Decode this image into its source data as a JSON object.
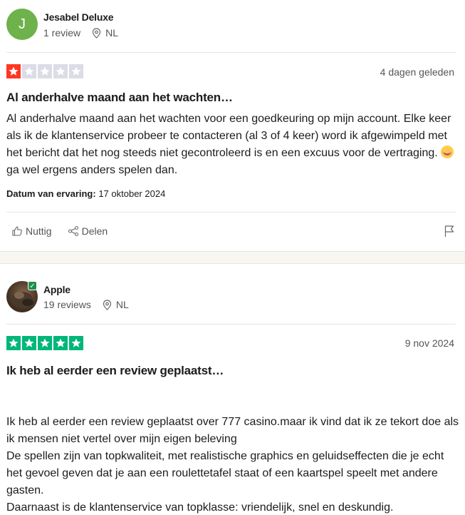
{
  "reviews": [
    {
      "reviewer": {
        "initial": "J",
        "name": "Jesabel Deluxe",
        "review_count": "1 review",
        "country": "NL",
        "avatar_color": "#6db24a"
      },
      "rating": 1,
      "star_color": "#ff3722",
      "date": "4 dagen geleden",
      "title": "Al anderhalve maand aan het wachten…",
      "body_before_emoji": "Al anderhalve maand aan het wachten voor een goedkeuring op mijn account. Elke keer als ik de klantenservice probeer te contacteren (al 3 of 4 keer) word ik afgewimpeld met het bericht dat het nog steeds niet gecontroleerd is en een excuus voor de vertraging. ",
      "body_after_emoji": " ga wel ergens anders spelen dan.",
      "emoji_icon": "grinning-squinting-face-icon",
      "experience_label": "Datum van ervaring:",
      "experience_date": "17 oktober 2024",
      "actions": {
        "useful": "Nuttig",
        "share": "Delen"
      }
    },
    {
      "reviewer": {
        "name": "Apple",
        "review_count": "19 reviews",
        "country": "NL",
        "verified": true
      },
      "rating": 5,
      "star_color": "#00b67a",
      "date": "9 nov 2024",
      "title": "Ik heb al eerder een review geplaatst…",
      "body_lines": [
        "Ik heb al eerder een review geplaatst over 777 casino.maar ik vind dat ik ze tekort doe als ik mensen niet vertel over mijn eigen beleving",
        "De spellen zijn van topkwaliteit, met realistische graphics en geluidseffecten die je echt het gevoel geven dat je aan een roulettetafel staat of een kaartspel speelt met andere gasten.",
        "Daarnaast is de klantenservice van topklasse: vriendelijk, snel en deskundig."
      ]
    }
  ]
}
